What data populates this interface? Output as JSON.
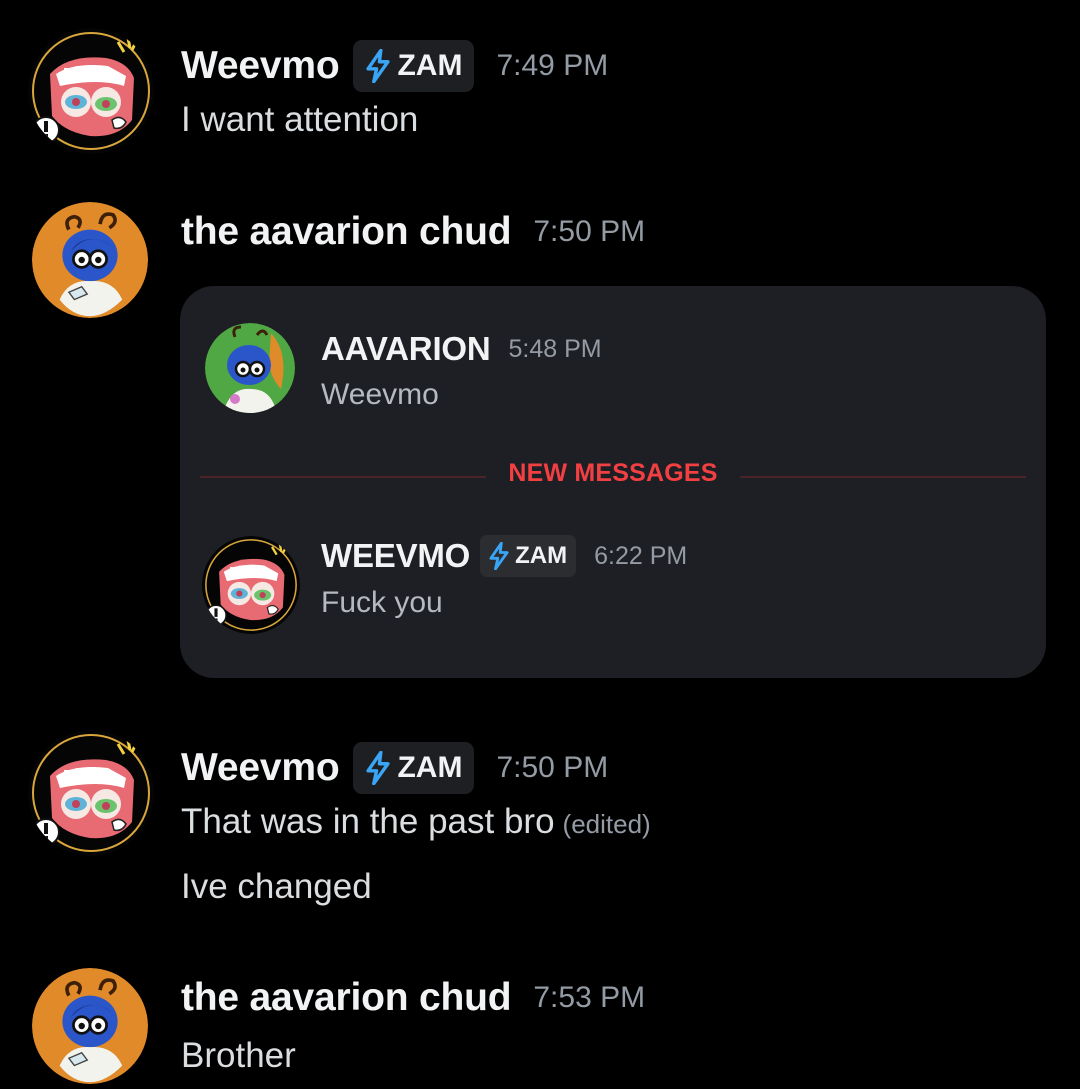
{
  "messages": [
    {
      "username": "Weevmo",
      "tag": "ZAM",
      "time": "7:49 PM",
      "lines": [
        "I want attention"
      ]
    },
    {
      "username": "the aavarion chud",
      "time": "7:50 PM",
      "forwarded": {
        "first": {
          "username": "AAVARION",
          "time": "5:48 PM",
          "text": "Weevmo"
        },
        "divider_label": "NEW MESSAGES",
        "second": {
          "username": "WEEVMO",
          "tag": "ZAM",
          "time": "6:22 PM",
          "text": "Fuck you"
        }
      }
    },
    {
      "username": "Weevmo",
      "tag": "ZAM",
      "time": "7:50 PM",
      "lines": [
        "That was in the past bro",
        "Ive changed"
      ],
      "edited_label": "(edited)"
    },
    {
      "username": "the aavarion chud",
      "time": "7:53 PM",
      "lines": [
        "Brother"
      ]
    }
  ],
  "colors": {
    "background": "#000000",
    "card": "#1e1f24",
    "new_messages_red": "#f23f42",
    "timestamp": "#949ba4",
    "bolt_blue": "#3ba5f5"
  },
  "icons": {
    "tag_icon": "lightning-bolt-icon",
    "weevmo_avatar": "weevmo-avatar-icon",
    "chud_avatar": "chud-avatar-icon",
    "aavarion_avatar": "aavarion-avatar-icon"
  }
}
